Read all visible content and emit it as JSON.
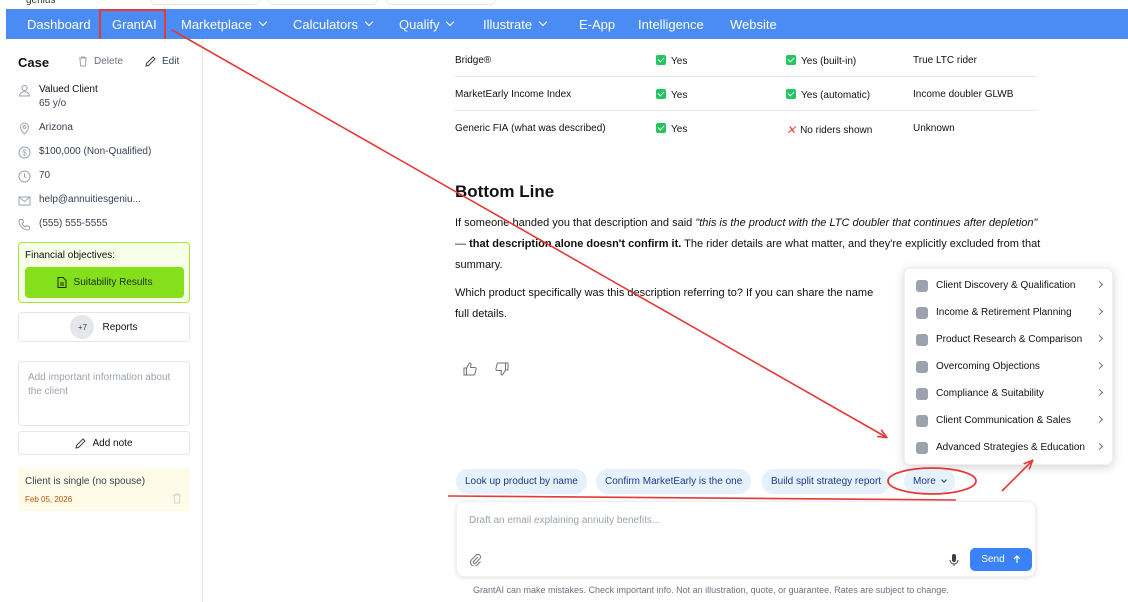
{
  "topbar": {
    "logo_text": "genius"
  },
  "nav": {
    "items": [
      {
        "label": "Dashboard",
        "dropdown": false
      },
      {
        "label": "GrantAI",
        "dropdown": false
      },
      {
        "label": "Marketplace",
        "dropdown": true
      },
      {
        "label": "Calculators",
        "dropdown": true
      },
      {
        "label": "Qualify",
        "dropdown": true
      },
      {
        "label": "Illustrate",
        "dropdown": true
      },
      {
        "label": "E-App",
        "dropdown": false
      },
      {
        "label": "Intelligence",
        "dropdown": false
      },
      {
        "label": "Website",
        "dropdown": false
      }
    ],
    "bg_color": "#4a8cf3"
  },
  "sidebar": {
    "title": "Case",
    "delete_label": "Delete",
    "edit_label": "Edit",
    "client_name": "Valued Client",
    "client_age": "65 y/o",
    "state": "Arizona",
    "amount": "$100,000 (Non-Qualified)",
    "score": "70",
    "email": "help@annuitiesgeniu...",
    "phone": "(555) 555-5555",
    "financial_objectives_label": "Financial objectives:",
    "suitability_label": "Suitability Results",
    "reports_badge": "+7",
    "reports_label": "Reports",
    "note_placeholder": "Add important information about the client",
    "add_note_label": "Add note",
    "note_text": "Client is single (no spouse)",
    "note_date": "Feb 05, 2026"
  },
  "table": {
    "rows": [
      {
        "product": "Bridge®",
        "product_note": "",
        "col2": "Yes",
        "col3": "Yes (built-in)",
        "col3_type": "check",
        "col4": "True LTC rider"
      },
      {
        "product": "MarketEarly Income Index",
        "product_note": "",
        "col2": "Yes",
        "col3": "Yes (automatic)",
        "col3_type": "check",
        "col4": "Income doubler GLWB"
      },
      {
        "product": "Generic FIA",
        "product_note": "(what was described)",
        "col2": "Yes",
        "col3": "No riders shown",
        "col3_type": "x",
        "col4": "Unknown"
      }
    ]
  },
  "content": {
    "heading": "Bottom Line",
    "p1_a": "If someone handed you that description and said ",
    "p1_quote": "\"this is the product with the LTC doubler that continues after depletion\"",
    "p1_b": " — ",
    "p1_bold": "that description alone doesn't confirm it.",
    "p1_c": " The rider details are what matter, and they're explicitly excluded from that summary.",
    "p2_line1": "Which product specifically was this description referring to? If you can share the name",
    "p2_line2": "full details."
  },
  "menu": {
    "items": [
      "Client Discovery & Qualification",
      "Income & Retirement Planning",
      "Product Research & Comparison",
      "Overcoming Objections",
      "Compliance & Suitability",
      "Client Communication & Sales",
      "Advanced Strategies & Education"
    ]
  },
  "chips": [
    "Look up product by name",
    "Confirm MarketEarly is the one",
    "Build split strategy report",
    "More"
  ],
  "composer": {
    "placeholder": "Draft an email explaining annuity benefits...",
    "send_label": "Send"
  },
  "footer": "GrantAI can make mistakes. Check important info. Not an illustration, quote, or guarantee. Rates are subject to change.",
  "colors": {
    "annotation": "#e53935",
    "accent": "#3b82f6",
    "success": "#22c55e",
    "lime": "#84e01a"
  }
}
